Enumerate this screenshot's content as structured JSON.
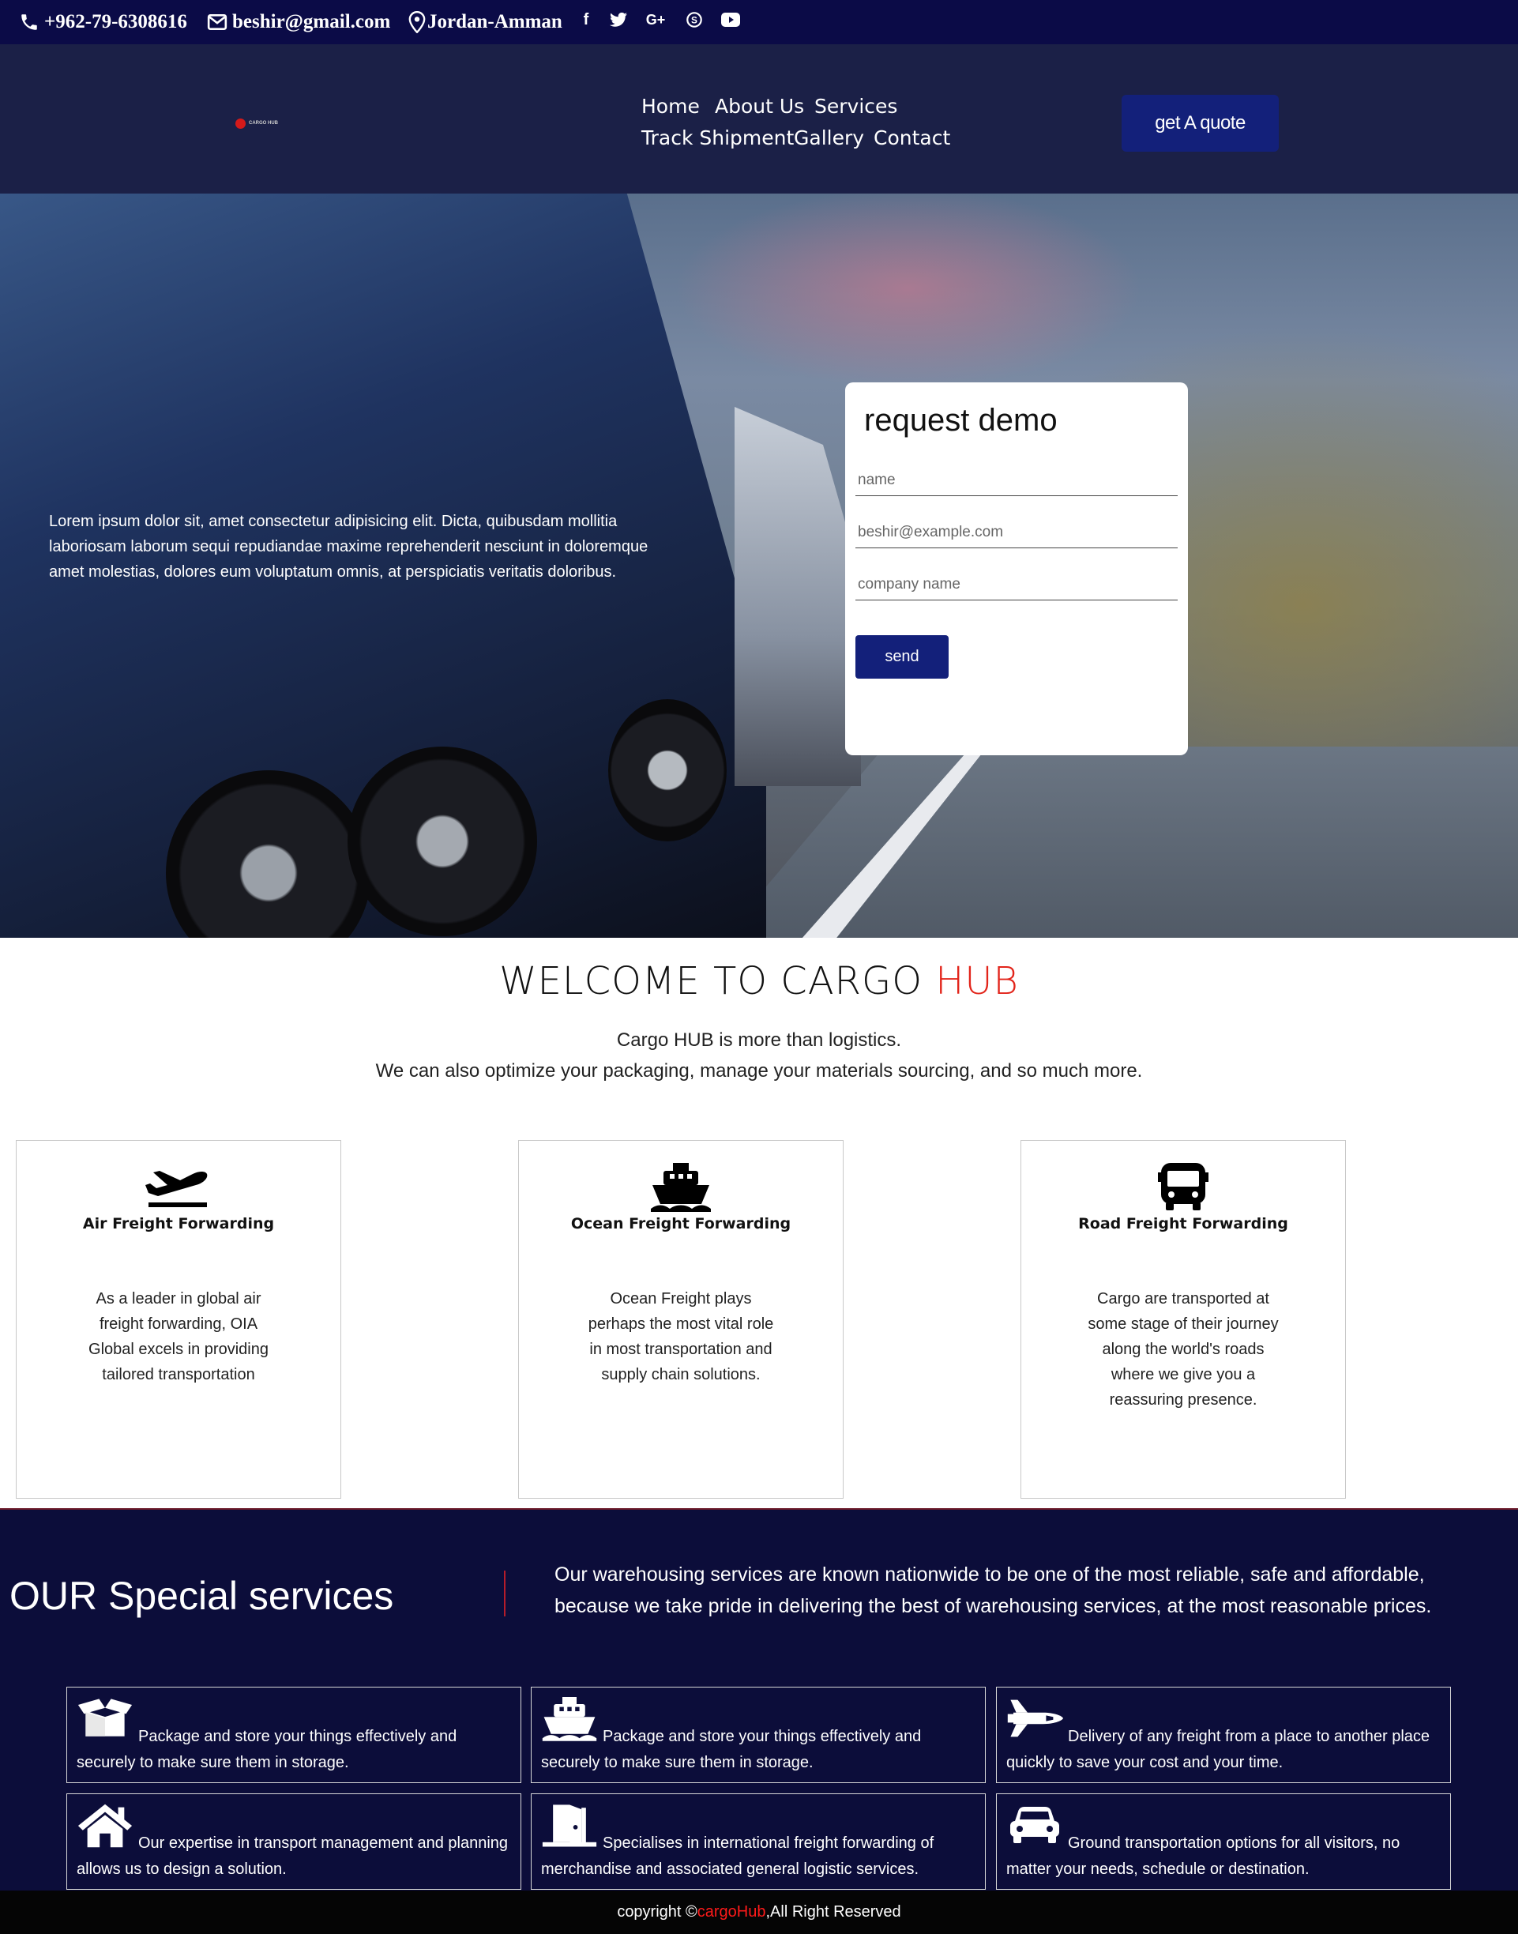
{
  "topbar": {
    "phone": "+962-79-6308616",
    "email": "beshir@gmail.com",
    "location": "Jordan-Amman",
    "socials": [
      {
        "name": "facebook",
        "glyph": "f"
      },
      {
        "name": "twitter",
        "glyph": "t"
      },
      {
        "name": "google-plus",
        "glyph": "G+"
      },
      {
        "name": "skype",
        "glyph": "S"
      },
      {
        "name": "youtube",
        "glyph": "▶"
      }
    ]
  },
  "nav": {
    "logo_text": "CARGO HUB",
    "links": [
      "Home",
      "About Us",
      "Services",
      "Track Shipment",
      "Gallery",
      "Contact"
    ],
    "quote_button": "get A quote"
  },
  "hero": {
    "text": "Lorem ipsum dolor sit, amet consectetur adipisicing elit. Dicta, quibusdam mollitia laboriosam laborum sequi repudiandae maxime reprehenderit nesciunt in doloremque amet molestias, dolores eum voluptatum omnis, at perspiciatis veritatis doloribus.",
    "form": {
      "title": "request demo",
      "name_placeholder": "name",
      "email_placeholder": "beshir@example.com",
      "company_placeholder": "company name",
      "send_label": "send"
    }
  },
  "welcome": {
    "title_main": "WELCOME TO CARGO ",
    "title_accent": "HUB",
    "line1": "Cargo HUB is more than logistics.",
    "line2": "We can also optimize your packaging, manage your materials sourcing, and so much more."
  },
  "services": [
    {
      "icon": "plane-departure-icon",
      "title": "Air Freight Forwarding",
      "desc": "As a leader in global air freight forwarding, OIA Global excels in providing tailored transportation"
    },
    {
      "icon": "ship-icon",
      "title": "Ocean Freight Forwarding",
      "desc": "Ocean Freight plays perhaps the most vital role in most transportation and supply chain solutions."
    },
    {
      "icon": "bus-icon",
      "title": "Road Freight Forwarding",
      "desc": "Cargo are transported at some stage of their journey along the world's roads where we give you a reassuring presence."
    }
  ],
  "special": {
    "title": "OUR Special services",
    "text": "Our warehousing services are known nationwide to be one of the most reliable, safe and affordable, because we take pride in delivering the best of warehousing services, at the most reasonable prices.",
    "items": [
      {
        "icon": "box-open-icon",
        "text": "Package and store your things effectively and securely to make sure them in storage."
      },
      {
        "icon": "ship-icon",
        "text": "Package and store your things effectively and securely to make sure them in storage."
      },
      {
        "icon": "space-shuttle-icon",
        "text": "Delivery of any freight from a place to another place quickly to save your cost and your time."
      },
      {
        "icon": "home-icon",
        "text": "Our expertise in transport management and planning allows us to design a solution."
      },
      {
        "icon": "door-open-icon",
        "text": "Specialises in international freight forwarding of merchandise and associated general logistic services."
      },
      {
        "icon": "car-icon",
        "text": "Ground transportation options for all visitors, no matter your needs, schedule or destination."
      }
    ]
  },
  "footer": {
    "prefix": "copyright © ",
    "brand": "cargoHub",
    "suffix": ",All Right Reserved"
  },
  "colors": {
    "topbar": "#0b0b47",
    "navbar": "#1b2047",
    "button": "#13207a",
    "accent_red": "#e2241a",
    "special_bg": "#0c0d3a"
  }
}
